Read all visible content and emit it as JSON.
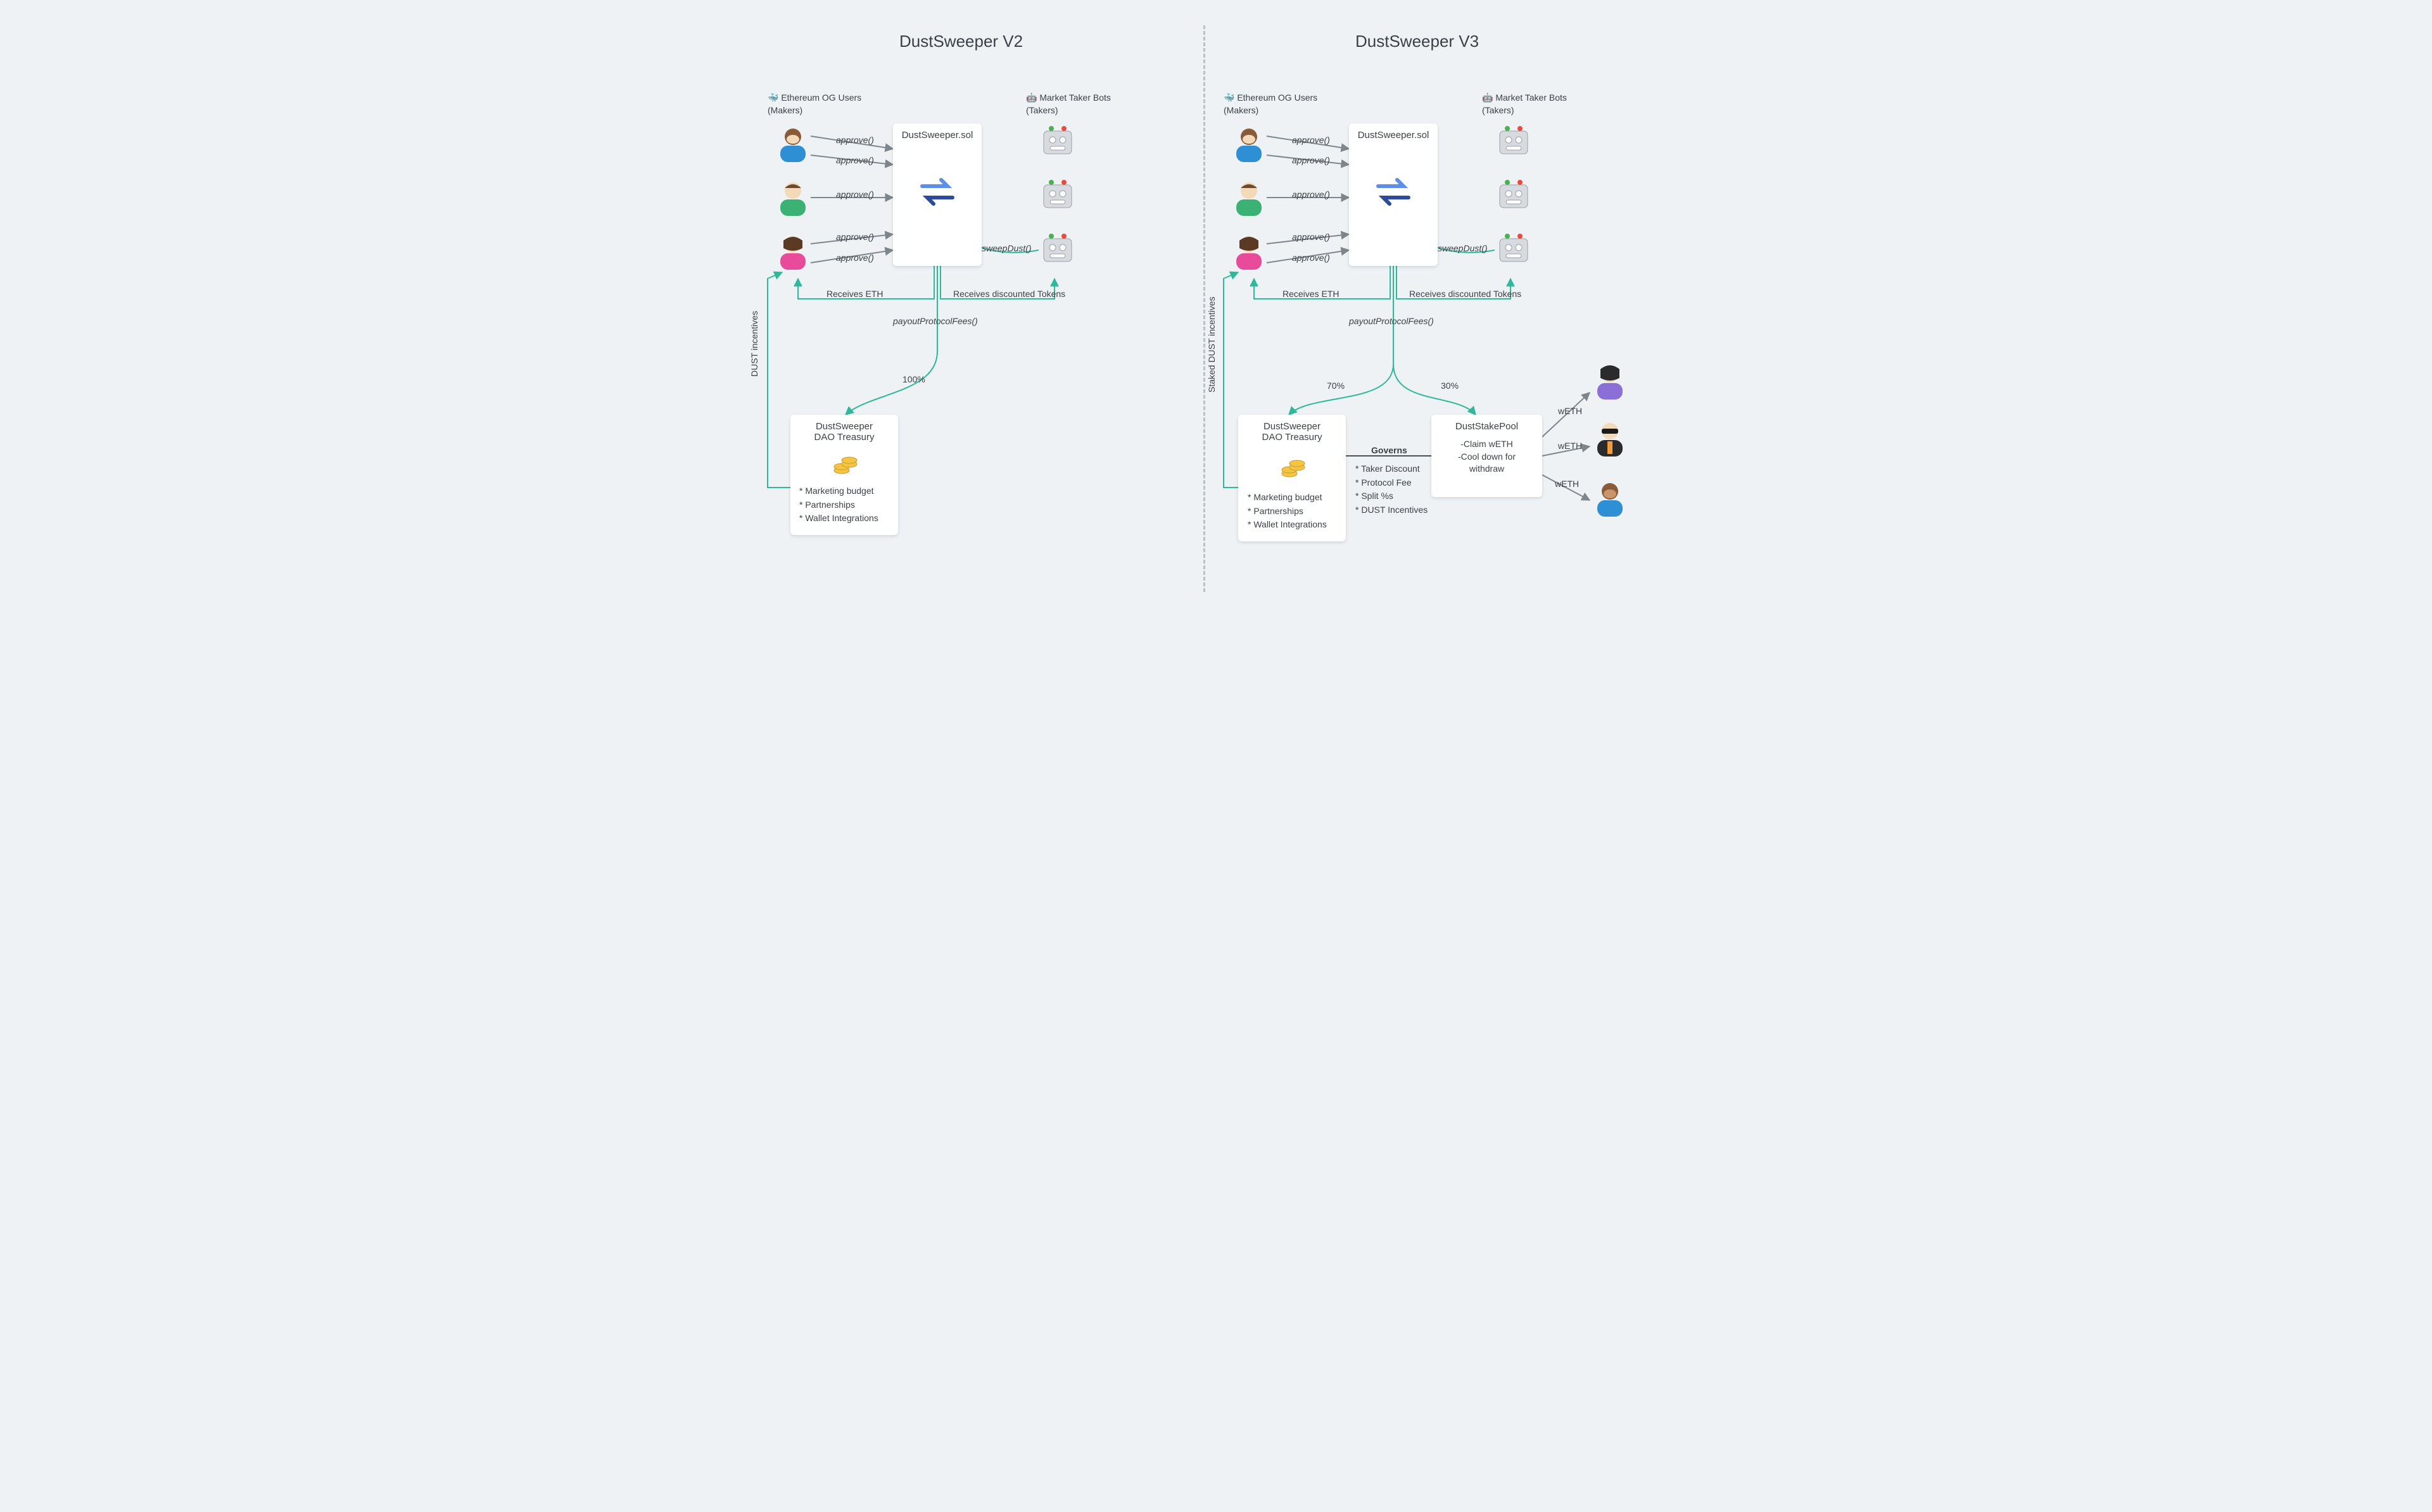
{
  "titles": {
    "v2": "DustSweeper V2",
    "v3": "DustSweeper V3"
  },
  "nodes": {
    "makers_header": "Ethereum OG Users\n(Makers)",
    "takers_header": "Market Taker Bots\n(Takers)",
    "contract": "DustSweeper.sol",
    "treasury_title": "DustSweeper\nDAO Treasury",
    "stakepool_title": "DustStakePool",
    "stakepool_lines": "-Claim wETH\n-Cool down for\nwithdraw"
  },
  "edges": {
    "approve": "approve()",
    "sweepDust": "sweepDust()",
    "receives_eth": "Receives ETH",
    "receives_tokens": "Receives discounted Tokens",
    "payout": "payoutProtocolFees()",
    "pct100": "100%",
    "pct70": "70%",
    "pct30": "30%",
    "dust_incentives_v2": "DUST incentives",
    "dust_incentives_v3": "Staked DUST incentives",
    "governs": "Governs",
    "weth": "wETH"
  },
  "treasury_bullets": "* Marketing budget\n* Partnerships\n* Wallet Integrations",
  "governs_bullets": "* Taker Discount\n* Protocol Fee\n* Split %s\n* DUST Incentives",
  "icons": {
    "whale": "🐳",
    "bot": "🤖"
  }
}
